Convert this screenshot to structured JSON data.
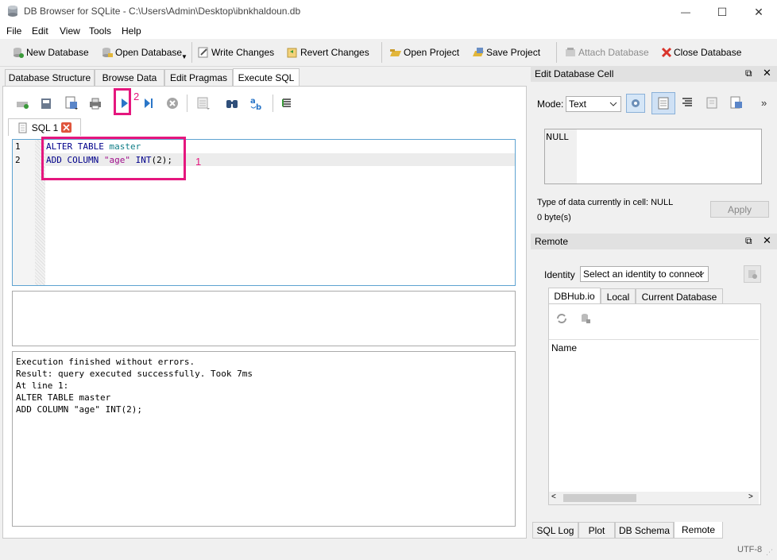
{
  "window": {
    "title": "DB Browser for SQLite - C:\\Users\\Admin\\Desktop\\ibnkhaldoun.db",
    "minimize": "—",
    "maximize": "☐",
    "close": "✕"
  },
  "menu": [
    "File",
    "Edit",
    "View",
    "Tools",
    "Help"
  ],
  "toolbar": {
    "new_database": "New Database",
    "open_database": "Open Database",
    "write_changes": "Write Changes",
    "revert_changes": "Revert Changes",
    "open_project": "Open Project",
    "save_project": "Save Project",
    "attach_database": "Attach Database",
    "close_database": "Close Database"
  },
  "main_tabs": [
    "Database Structure",
    "Browse Data",
    "Edit Pragmas",
    "Execute SQL"
  ],
  "sql_tab": {
    "label": "SQL 1"
  },
  "editor": {
    "line_numbers": [
      "1",
      "2"
    ],
    "line1": {
      "kw": "ALTER TABLE",
      "table": "master"
    },
    "line2": {
      "kw1": "ADD COLUMN",
      "str": "\"age\"",
      "kw2": "INT",
      "rest": "(2);"
    }
  },
  "annotations": {
    "one": "1",
    "two": "2"
  },
  "messages": [
    "Execution finished without errors.",
    "Result: query executed successfully. Took 7ms",
    "At line 1:",
    "ALTER TABLE master",
    "ADD COLUMN \"age\" INT(2);"
  ],
  "edit_cell": {
    "title": "Edit Database Cell",
    "mode_label": "Mode:",
    "mode_value": "Text",
    "cell_value": "NULL",
    "type_info": "Type of data currently in cell: NULL",
    "size_info": "0 byte(s)",
    "apply": "Apply",
    "more": "»"
  },
  "remote": {
    "title": "Remote",
    "identity_label": "Identity",
    "identity_value": "Select an identity to connect",
    "tabs": [
      "DBHub.io",
      "Local",
      "Current Database"
    ],
    "column_name": "Name"
  },
  "bottom_tabs": [
    "SQL Log",
    "Plot",
    "DB Schema",
    "Remote"
  ],
  "status": {
    "encoding": "UTF-8"
  },
  "colors": {
    "accent": "#e5177e",
    "editor_border": "#5ea3d1",
    "keyword": "#00008b",
    "table": "#0e7d86",
    "string": "#a0108c"
  }
}
